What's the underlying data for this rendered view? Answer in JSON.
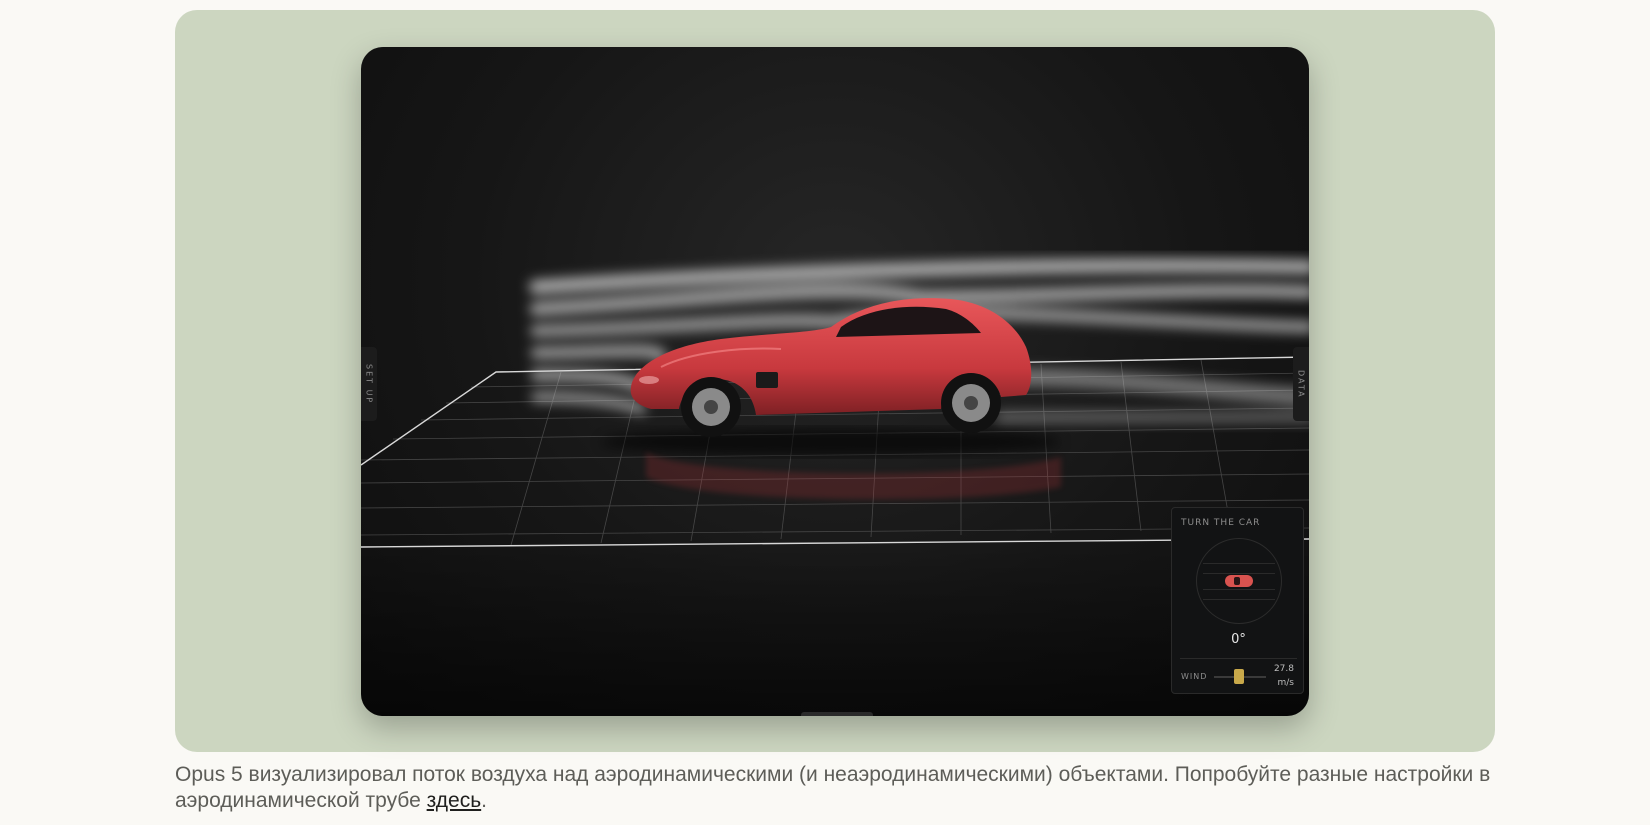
{
  "viewport": {
    "left_tab_label": "SET UP",
    "right_tab_label": "DATA"
  },
  "control_panel": {
    "title": "TURN THE CAR",
    "angle": "0°",
    "wind_label": "WIND",
    "wind_value": "27.8",
    "wind_unit": "m/s"
  },
  "caption": {
    "text_before_link": "Opus 5 визуализировал поток воздуха над аэродинамическими (и неаэродинамическими) объектами. Попробуйте разные настройки в аэродинамической трубе ",
    "link_text": "здесь",
    "text_after_link": "."
  },
  "colors": {
    "card_background": "#ccd6c0",
    "car_body": "#d9534f",
    "slider_thumb": "#c9a94a"
  }
}
